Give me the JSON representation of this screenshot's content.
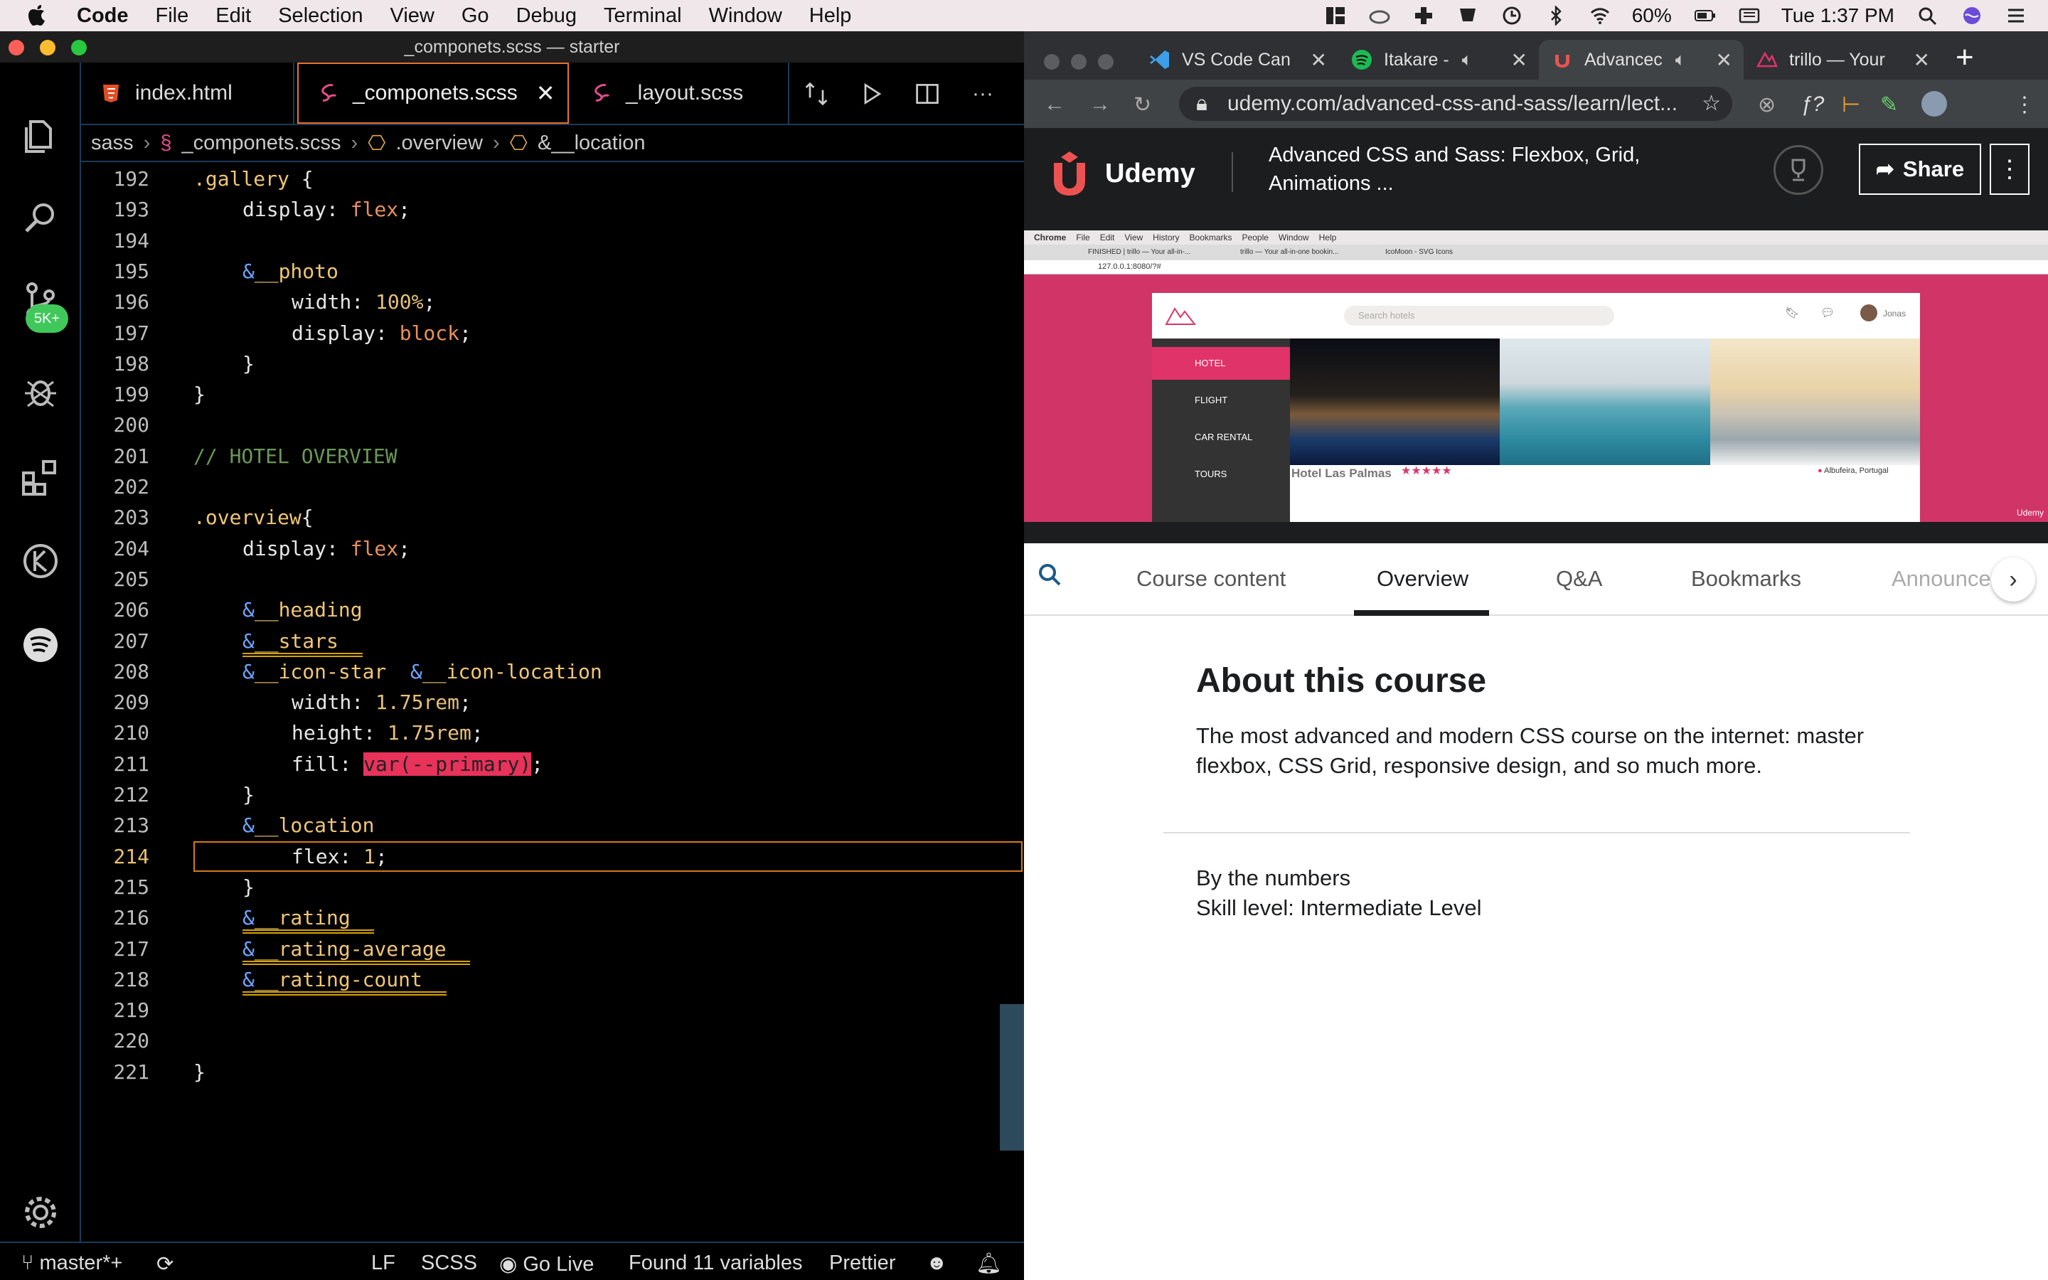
{
  "menubar": {
    "app": "Code",
    "items": [
      "File",
      "Edit",
      "Selection",
      "View",
      "Go",
      "Debug",
      "Terminal",
      "Window",
      "Help"
    ],
    "battery": "60%",
    "clock": "Tue 1:37 PM"
  },
  "vscode": {
    "title": "_componets.scss — starter",
    "badge": "5K+",
    "tabs": [
      {
        "label": "index.html"
      },
      {
        "label": "_componets.scss"
      },
      {
        "label": "_layout.scss"
      }
    ],
    "breadcrumb": [
      "sass",
      "_componets.scss",
      ".overview",
      "&__location"
    ],
    "lines": [
      {
        "n": "192",
        "t": ".gallery {"
      },
      {
        "n": "193",
        "t": "display: flex;"
      },
      {
        "n": "194",
        "t": ""
      },
      {
        "n": "195",
        "t": "&__photo {"
      },
      {
        "n": "196",
        "t": "width: 100%;"
      },
      {
        "n": "197",
        "t": "display: block;"
      },
      {
        "n": "198",
        "t": "}"
      },
      {
        "n": "199",
        "t": "}"
      },
      {
        "n": "200",
        "t": ""
      },
      {
        "n": "201",
        "t": "// HOTEL OVERVIEW"
      },
      {
        "n": "202",
        "t": ""
      },
      {
        "n": "203",
        "t": ".overview{"
      },
      {
        "n": "204",
        "t": "display: flex;"
      },
      {
        "n": "205",
        "t": ""
      },
      {
        "n": "206",
        "t": "&__heading{}"
      },
      {
        "n": "207",
        "t": "&__stars{}"
      },
      {
        "n": "208",
        "t": "&__icon-star, &__icon-location{"
      },
      {
        "n": "209",
        "t": "width: 1.75rem;"
      },
      {
        "n": "210",
        "t": "height: 1.75rem;"
      },
      {
        "n": "211",
        "t": "fill: var(--primary);"
      },
      {
        "n": "212",
        "t": "}"
      },
      {
        "n": "213",
        "t": "&__location{"
      },
      {
        "n": "214",
        "t": "flex: 1;"
      },
      {
        "n": "215",
        "t": "}"
      },
      {
        "n": "216",
        "t": "&__rating{}"
      },
      {
        "n": "217",
        "t": "&__rating-average{}"
      },
      {
        "n": "218",
        "t": "&__rating-count{}"
      },
      {
        "n": "219",
        "t": ""
      },
      {
        "n": "220",
        "t": ""
      },
      {
        "n": "221",
        "t": "}"
      }
    ],
    "status": {
      "branch": "master*+",
      "eol": "LF",
      "lang": "SCSS",
      "golive": "Go Live",
      "vars": "Found 11 variables",
      "prettier": "Prettier"
    }
  },
  "browser": {
    "tabs": [
      {
        "label": "VS Code Can"
      },
      {
        "label": "Itakare -"
      },
      {
        "label": "Advancec"
      },
      {
        "label": "trillo — Your"
      }
    ],
    "url": "udemy.com/advanced-css-and-sass/learn/lect...",
    "udemy": {
      "logo": "Udemy",
      "course": "Advanced CSS and Sass: Flexbox, Grid, Animations ...",
      "share": "Share"
    },
    "video": {
      "mini_menu": [
        "Chrome",
        "File",
        "Edit",
        "View",
        "History",
        "Bookmarks",
        "People",
        "Window",
        "Help"
      ],
      "mini_tabs": [
        "FINISHED | trillo — Your all-in-...",
        "trillo — Your all-in-one bookin...",
        "IcoMoon - SVG Icons"
      ],
      "mini_url": "127.0.0.1:8080/?#",
      "search_placeholder": "Search hotels",
      "user": "Jonas",
      "nav": [
        "HOTEL",
        "FLIGHT",
        "CAR RENTAL",
        "TOURS"
      ],
      "hotel": "Hotel Las Palmas",
      "stars": "★★★★★",
      "location": "Albufeira, Portugal",
      "watermark": "Udemy"
    },
    "course_tabs": [
      "Course content",
      "Overview",
      "Q&A",
      "Bookmarks",
      "Announce"
    ],
    "about_title": "About this course",
    "about_text": "The most advanced and modern CSS course on the internet: master flexbox, CSS Grid, responsive design, and so much more.",
    "numbers_title": "By the numbers",
    "skill": "Skill level: Intermediate Level"
  }
}
